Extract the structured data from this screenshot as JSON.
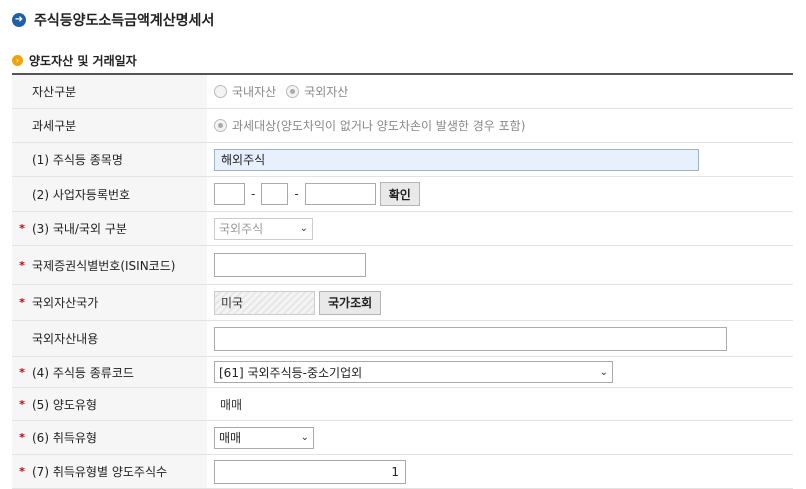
{
  "page": {
    "title": "주식등양도소득금액계산명세서",
    "title_icon": "arrow-right-circle-icon",
    "section_title": "양도자산 및 거래일자",
    "section_icon": "chevron-right-circle-icon"
  },
  "fields": {
    "asset_type": {
      "label": "자산구분",
      "options": [
        "국내자산",
        "국외자산"
      ],
      "selected": "국외자산"
    },
    "tax_type": {
      "label": "과세구분",
      "option": "과세대상(양도차익이 없거나 양도차손이 발생한 경우 포함)"
    },
    "stock_name": {
      "label": "(1) 주식등 종목명",
      "value": "해외주식"
    },
    "biz_reg_no": {
      "label": "(2) 사업자등록번호",
      "part1": "",
      "part2": "",
      "part3": "",
      "sep": "-",
      "button": "확인"
    },
    "domestic_foreign": {
      "label": "(3) 국내/국외 구분",
      "value": "국외주식",
      "required": "*"
    },
    "isin": {
      "label": "국제증권식별번호(ISIN코드)",
      "value": "",
      "required": "*"
    },
    "country": {
      "label": "국외자산국가",
      "value": "미국",
      "button": "국가조회",
      "required": "*"
    },
    "foreign_asset_desc": {
      "label": "국외자산내용",
      "value": ""
    },
    "stock_type_code": {
      "label": "(4) 주식등 종류코드",
      "value": "[61] 국외주식등-중소기업외",
      "required": "*"
    },
    "transfer_type": {
      "label": "(5) 양도유형",
      "value": "매매",
      "required": "*"
    },
    "acquisition_type": {
      "label": "(6) 취득유형",
      "value": "매매",
      "required": "*"
    },
    "transfer_qty": {
      "label": "(7) 취득유형별 양도주식수",
      "value": "1",
      "required": "*"
    }
  }
}
